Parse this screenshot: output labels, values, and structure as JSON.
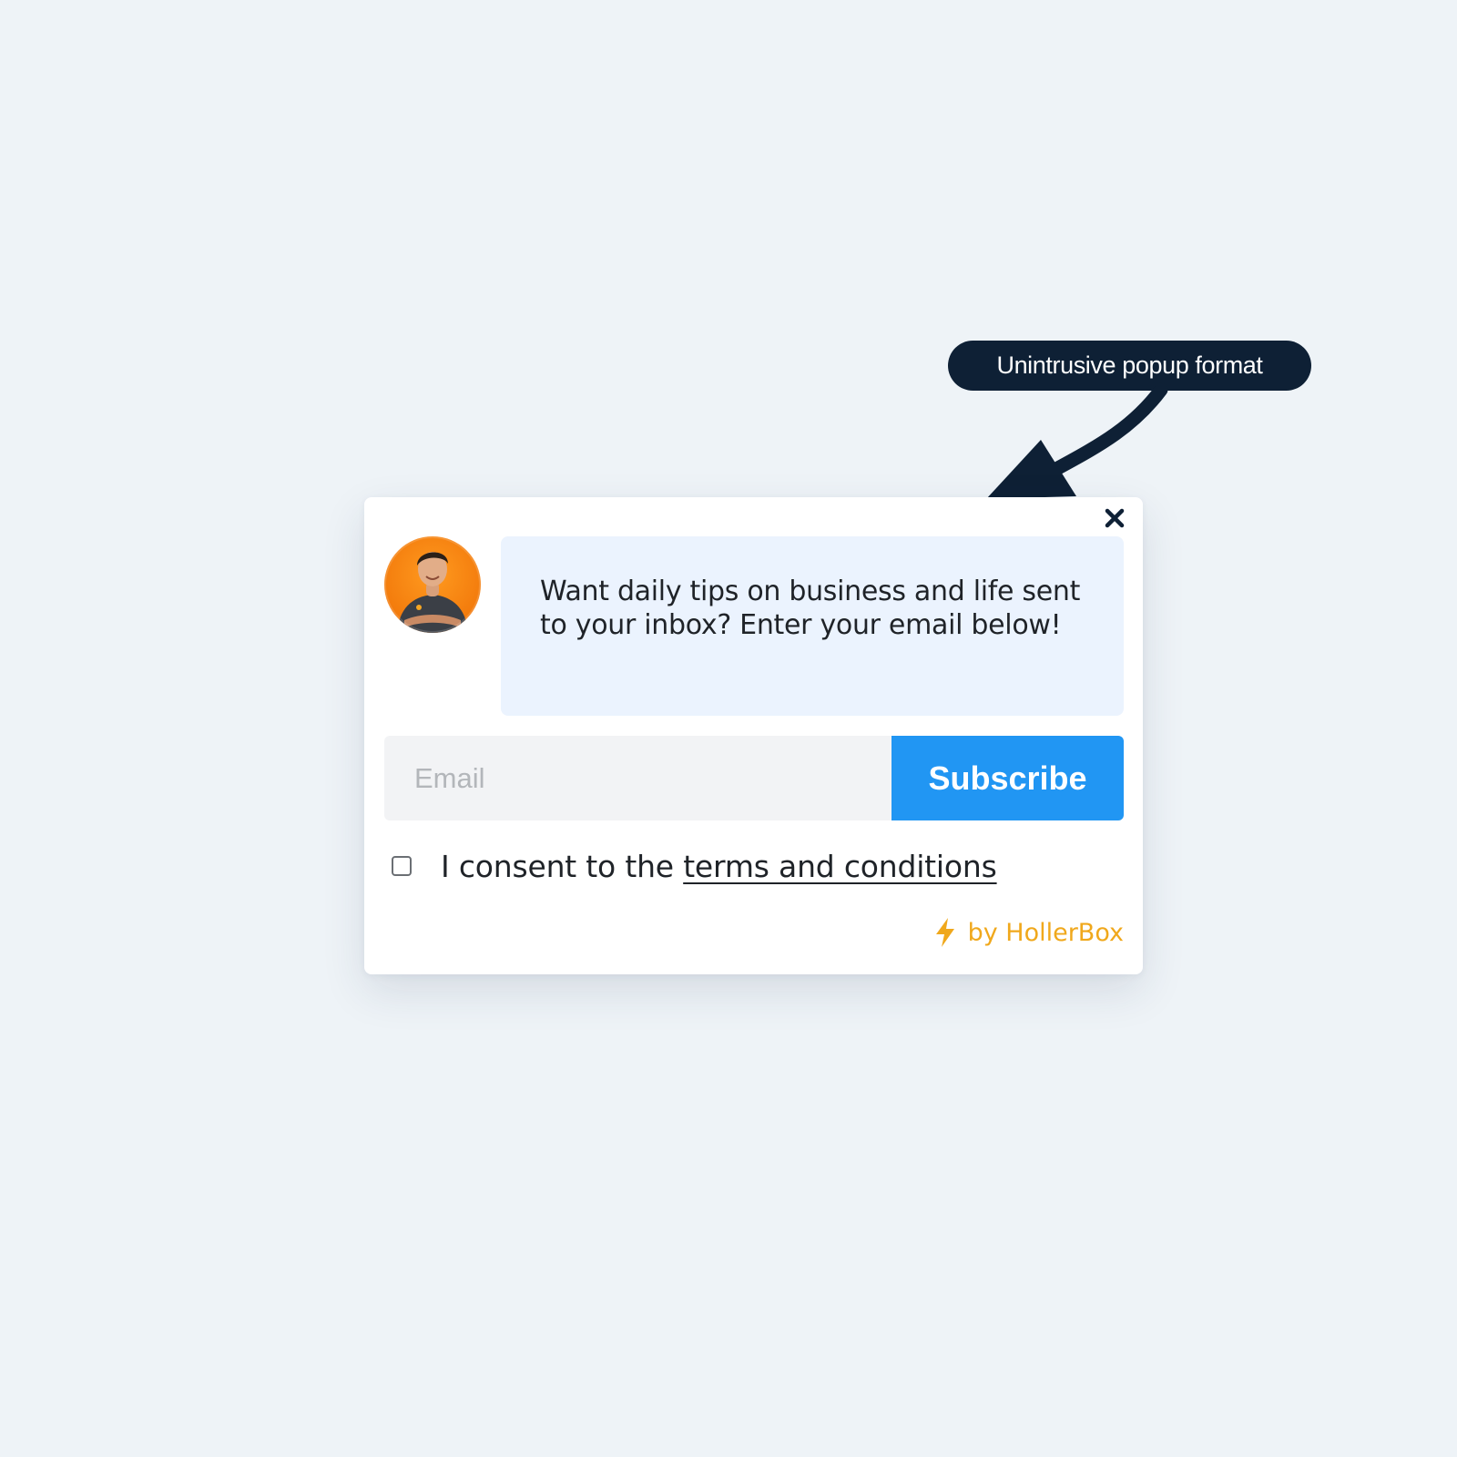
{
  "callout": {
    "label": "Unintrusive popup format"
  },
  "popup": {
    "message": "Want daily tips on business and life sent to your inbox? Enter your email below!",
    "email_placeholder": "Email",
    "email_value": "",
    "subscribe_label": "Subscribe",
    "consent_prefix": "I consent to the ",
    "consent_link": "terms and conditions",
    "consent_checked": false,
    "powered_by": "by HollerBox",
    "close_icon": "close-icon",
    "bolt_icon": "lightning-bolt-icon"
  },
  "colors": {
    "background": "#eef3f7",
    "callout": "#0e2035",
    "bubble": "#ebf3fe",
    "accent": "#2196f3",
    "brand": "#f0a81c",
    "avatar": "#f37b0c"
  }
}
